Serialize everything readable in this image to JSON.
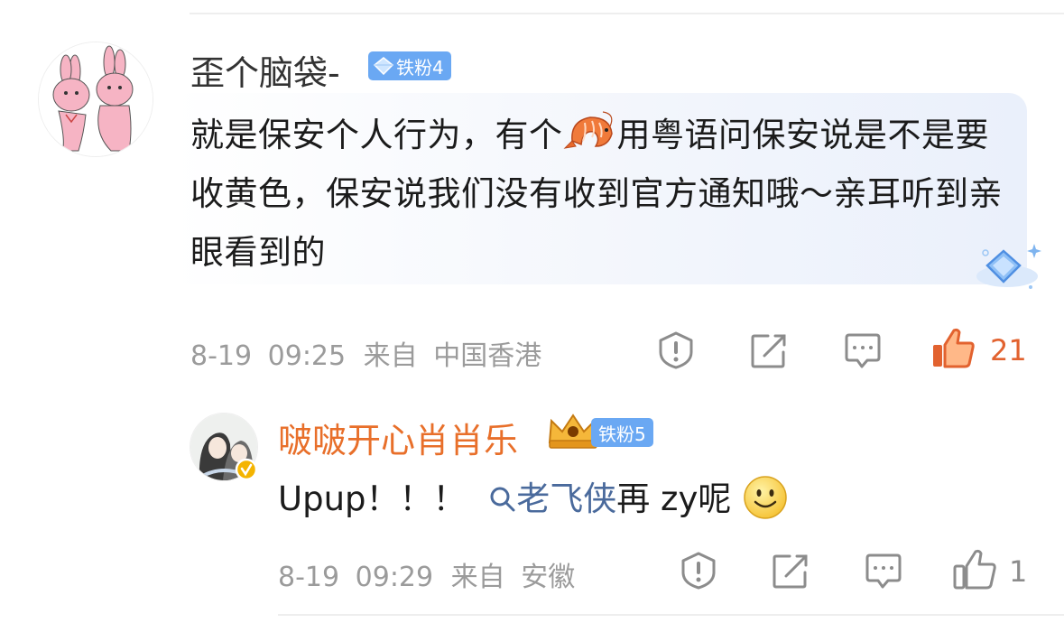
{
  "top_divider": true,
  "comment": {
    "username": "歪个脑袋-",
    "badge": "铁粉4",
    "text_before_emoji": "就是保安个人行为，有个",
    "emoji": "shrimp-emoji",
    "text_after_emoji": "用粤语问保安说是不是要收黄色，保安说我们没有收到官方通知哦～亲耳听到亲眼看到的",
    "date": "8-19",
    "time": "09:25",
    "from_label": "来自",
    "location": "中国香港",
    "likes": "21",
    "liked": true,
    "accent": "#e2622f"
  },
  "reply": {
    "username": "啵啵开心肖肖乐",
    "username_color": "#e86f2a",
    "badge": "铁粉5",
    "text_prefix": "Upup！！！",
    "link_text": "老飞侠",
    "text_after_link": "再 zy呢",
    "emoji": "smile-emoji",
    "date": "8-19",
    "time": "09:29",
    "from_label": "来自",
    "location": "安徽",
    "likes": "1",
    "link_color": "#4a6a9c"
  }
}
